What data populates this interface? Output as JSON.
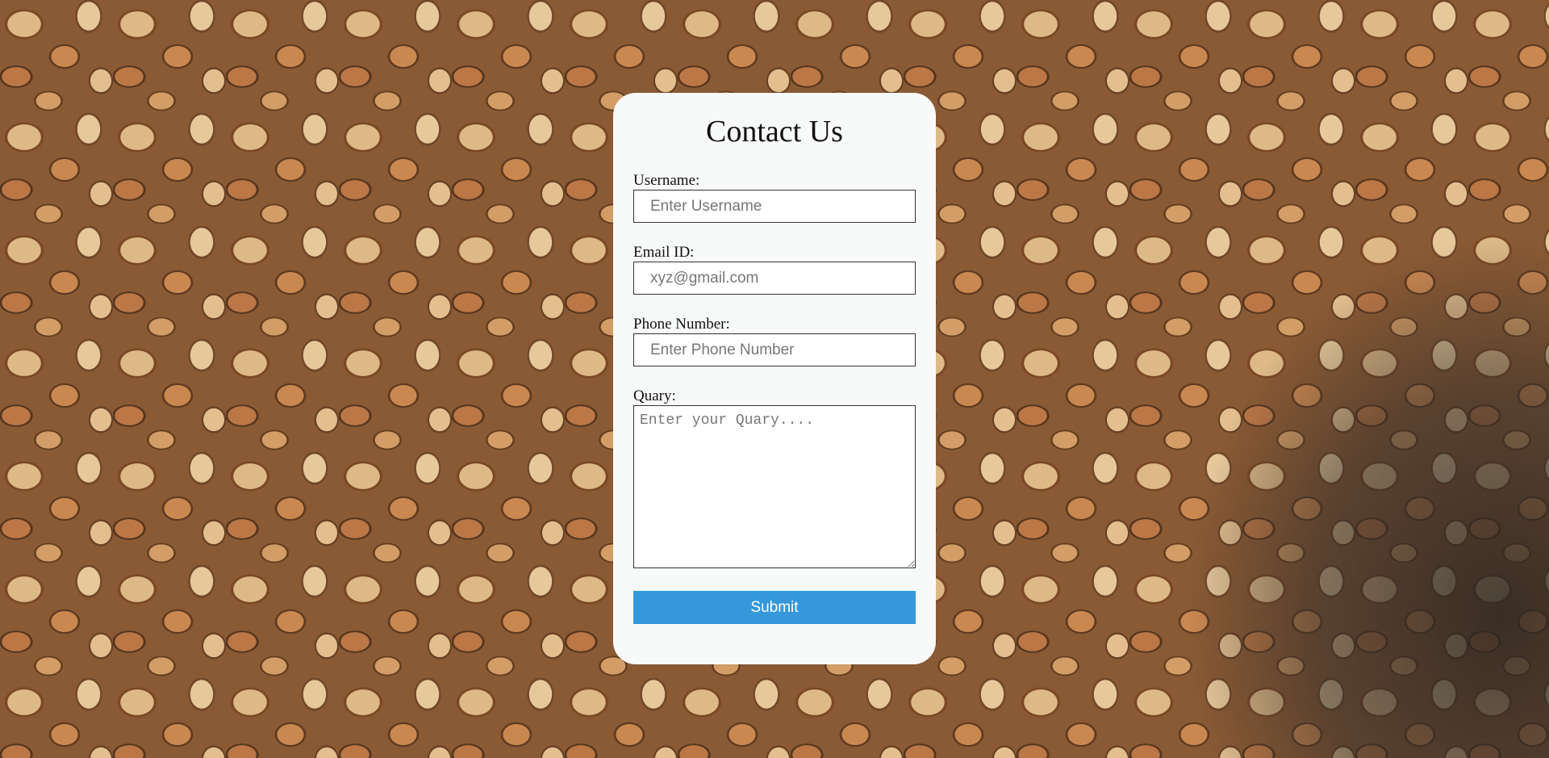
{
  "form": {
    "title": "Contact Us",
    "username": {
      "label": "Username:",
      "placeholder": "Enter Username"
    },
    "email": {
      "label": "Email ID:",
      "placeholder": "xyz@gmail.com"
    },
    "phone": {
      "label": "Phone Number:",
      "placeholder": "Enter Phone Number"
    },
    "quary": {
      "label": "Quary:",
      "placeholder": "Enter your Quary...."
    },
    "submit_label": "Submit"
  },
  "colors": {
    "card_background": "#f8fafa",
    "submit_button": "#3498db",
    "submit_text": "#ffffff"
  }
}
